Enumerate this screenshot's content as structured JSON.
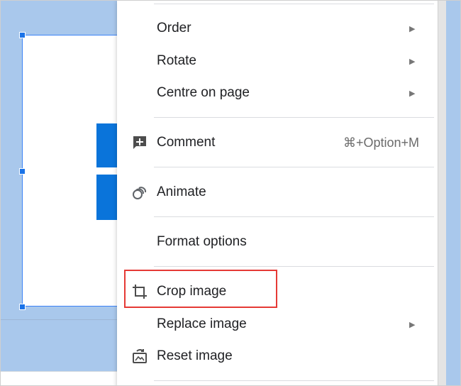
{
  "menu": {
    "items": [
      {
        "label": "Order",
        "has_submenu": true
      },
      {
        "label": "Rotate",
        "has_submenu": true
      },
      {
        "label": "Centre on page",
        "has_submenu": true
      },
      {
        "label": "Comment",
        "shortcut": "⌘+Option+M",
        "icon": "add-comment-icon"
      },
      {
        "label": "Animate",
        "icon": "animate-icon"
      },
      {
        "label": "Format options"
      },
      {
        "label": "Crop image",
        "icon": "crop-icon",
        "highlighted": true
      },
      {
        "label": "Replace image",
        "has_submenu": true
      },
      {
        "label": "Reset image",
        "icon": "reset-image-icon"
      }
    ],
    "submenu_arrow": "▶"
  },
  "colors": {
    "canvas": "#a9c8ec",
    "selection": "#1a73e8",
    "logo": "#0a74da",
    "highlight_border": "#e53935"
  }
}
